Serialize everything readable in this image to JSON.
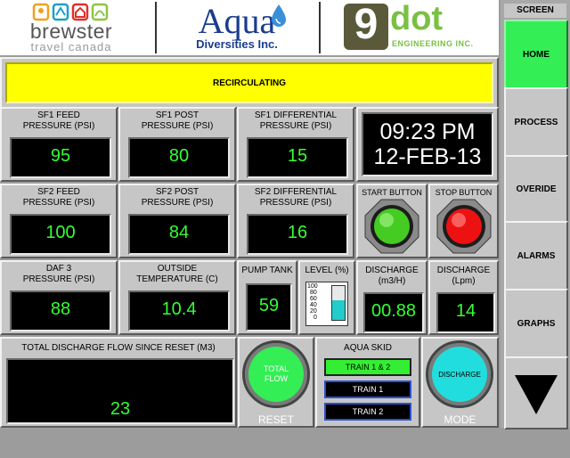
{
  "logos": {
    "brewster_name": "brewster",
    "brewster_sub": "travel canada",
    "aqua_name": "Aqua",
    "aqua_sub": "Diversities Inc.",
    "ninedot_digit": "9",
    "ninedot_word": "dot",
    "ninedot_sub": "ENGINEERING INC."
  },
  "status": {
    "text": "RECIRCULATING",
    "color": "#ffff00"
  },
  "sf1": {
    "feed_label": "SF1 FEED\nPRESSURE (PSI)",
    "feed_value": "95",
    "post_label": "SF1 POST\nPRESSURE (PSI)",
    "post_value": "80",
    "diff_label": "SF1 DIFFERENTIAL\nPRESSURE (PSI)",
    "diff_value": "15"
  },
  "sf2": {
    "feed_label": "SF2 FEED\nPRESSURE (PSI)",
    "feed_value": "100",
    "post_label": "SF2 POST\nPRESSURE (PSI)",
    "post_value": "84",
    "diff_label": "SF2 DIFFERENTIAL\nPRESSURE (PSI)",
    "diff_value": "16"
  },
  "clock": {
    "time": "09:23 PM",
    "date": "12-FEB-13"
  },
  "start": {
    "label": "START BUTTON",
    "color": "#44cc22"
  },
  "stop": {
    "label": "STOP BUTTON",
    "color": "#ee1111"
  },
  "daf": {
    "label": "DAF 3\nPRESSURE (PSI)",
    "value": "88"
  },
  "outside": {
    "label": "OUTSIDE\nTEMPERATURE (C)",
    "value": "10.4"
  },
  "pump_tank": {
    "label": "PUMP TANK",
    "value": "59"
  },
  "level": {
    "label": "LEVEL (%)",
    "ticks": [
      "100",
      "80",
      "60",
      "40",
      "20",
      "0"
    ],
    "fill_percent": 59
  },
  "discharge_m3h": {
    "label": "DISCHARGE\n(m3/H)",
    "value": "00.88"
  },
  "discharge_lpm": {
    "label": "DISCHARGE\n(Lpm)",
    "value": "14"
  },
  "total_flow": {
    "label": "TOTAL DISCHARGE FLOW SINCE RESET (M3)",
    "value": "23"
  },
  "total_flow_button": {
    "label": "TOTAL\nFLOW",
    "caption": "RESET",
    "color": "#33ee55"
  },
  "aqua_skid": {
    "label": "AQUA SKID",
    "trains": [
      {
        "label": "TRAIN 1 & 2",
        "active": true
      },
      {
        "label": "TRAIN 1",
        "active": false
      },
      {
        "label": "TRAIN 2",
        "active": false
      }
    ]
  },
  "discharge_button": {
    "label": "DISCHARGE",
    "caption": "MODE",
    "color": "#22dddd"
  },
  "sidebar": {
    "header": "SCREEN",
    "items": [
      {
        "label": "HOME",
        "active": true
      },
      {
        "label": "PROCESS",
        "active": false
      },
      {
        "label": "OVERIDE",
        "active": false
      },
      {
        "label": "ALARMS",
        "active": false
      },
      {
        "label": "GRAPHS",
        "active": false
      }
    ],
    "next_icon": "down-triangle-icon"
  }
}
